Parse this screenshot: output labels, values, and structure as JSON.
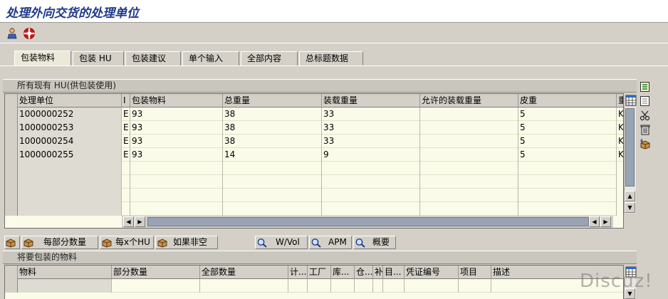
{
  "window": {
    "title": "处理外向交货的处理单位"
  },
  "tabs": [
    {
      "label": "包装物料",
      "active": true
    },
    {
      "label": "包装 HU",
      "active": false
    },
    {
      "label": "包装建议",
      "active": false
    },
    {
      "label": "单个输入",
      "active": false
    },
    {
      "label": "全部内容",
      "active": false
    },
    {
      "label": "总标题数据",
      "active": false
    }
  ],
  "hu_section": {
    "title": "所有现有 HU(供包装使用)",
    "columns": [
      "处理单位",
      "I",
      "包装物料",
      "总重量",
      "装载重量",
      "允许的装载重量",
      "皮重",
      "重"
    ],
    "rows": [
      [
        "1000000252",
        "E",
        "93",
        "38",
        "33",
        "",
        "5",
        "KG"
      ],
      [
        "1000000253",
        "E",
        "93",
        "38",
        "33",
        "",
        "5",
        "KG"
      ],
      [
        "1000000254",
        "E",
        "93",
        "38",
        "33",
        "",
        "5",
        "KG"
      ],
      [
        "1000000255",
        "E",
        "93",
        "14",
        "9",
        "",
        "5",
        "KG"
      ]
    ]
  },
  "action_buttons": {
    "partial_qty": "每部分数量",
    "per_x_hu": "每x个HU",
    "if_not_empty": "如果非空",
    "wvol": "W/Vol",
    "apm": "APM",
    "overview": "概要"
  },
  "material_section": {
    "title": "将要包装的物料",
    "columns": [
      "物料",
      "部分数量",
      "全部数量",
      "计...",
      "工厂",
      "库...",
      "仓...",
      "补",
      "目...",
      "凭证编号",
      "项目",
      "描述"
    ]
  },
  "watermark": "Discuz!"
}
